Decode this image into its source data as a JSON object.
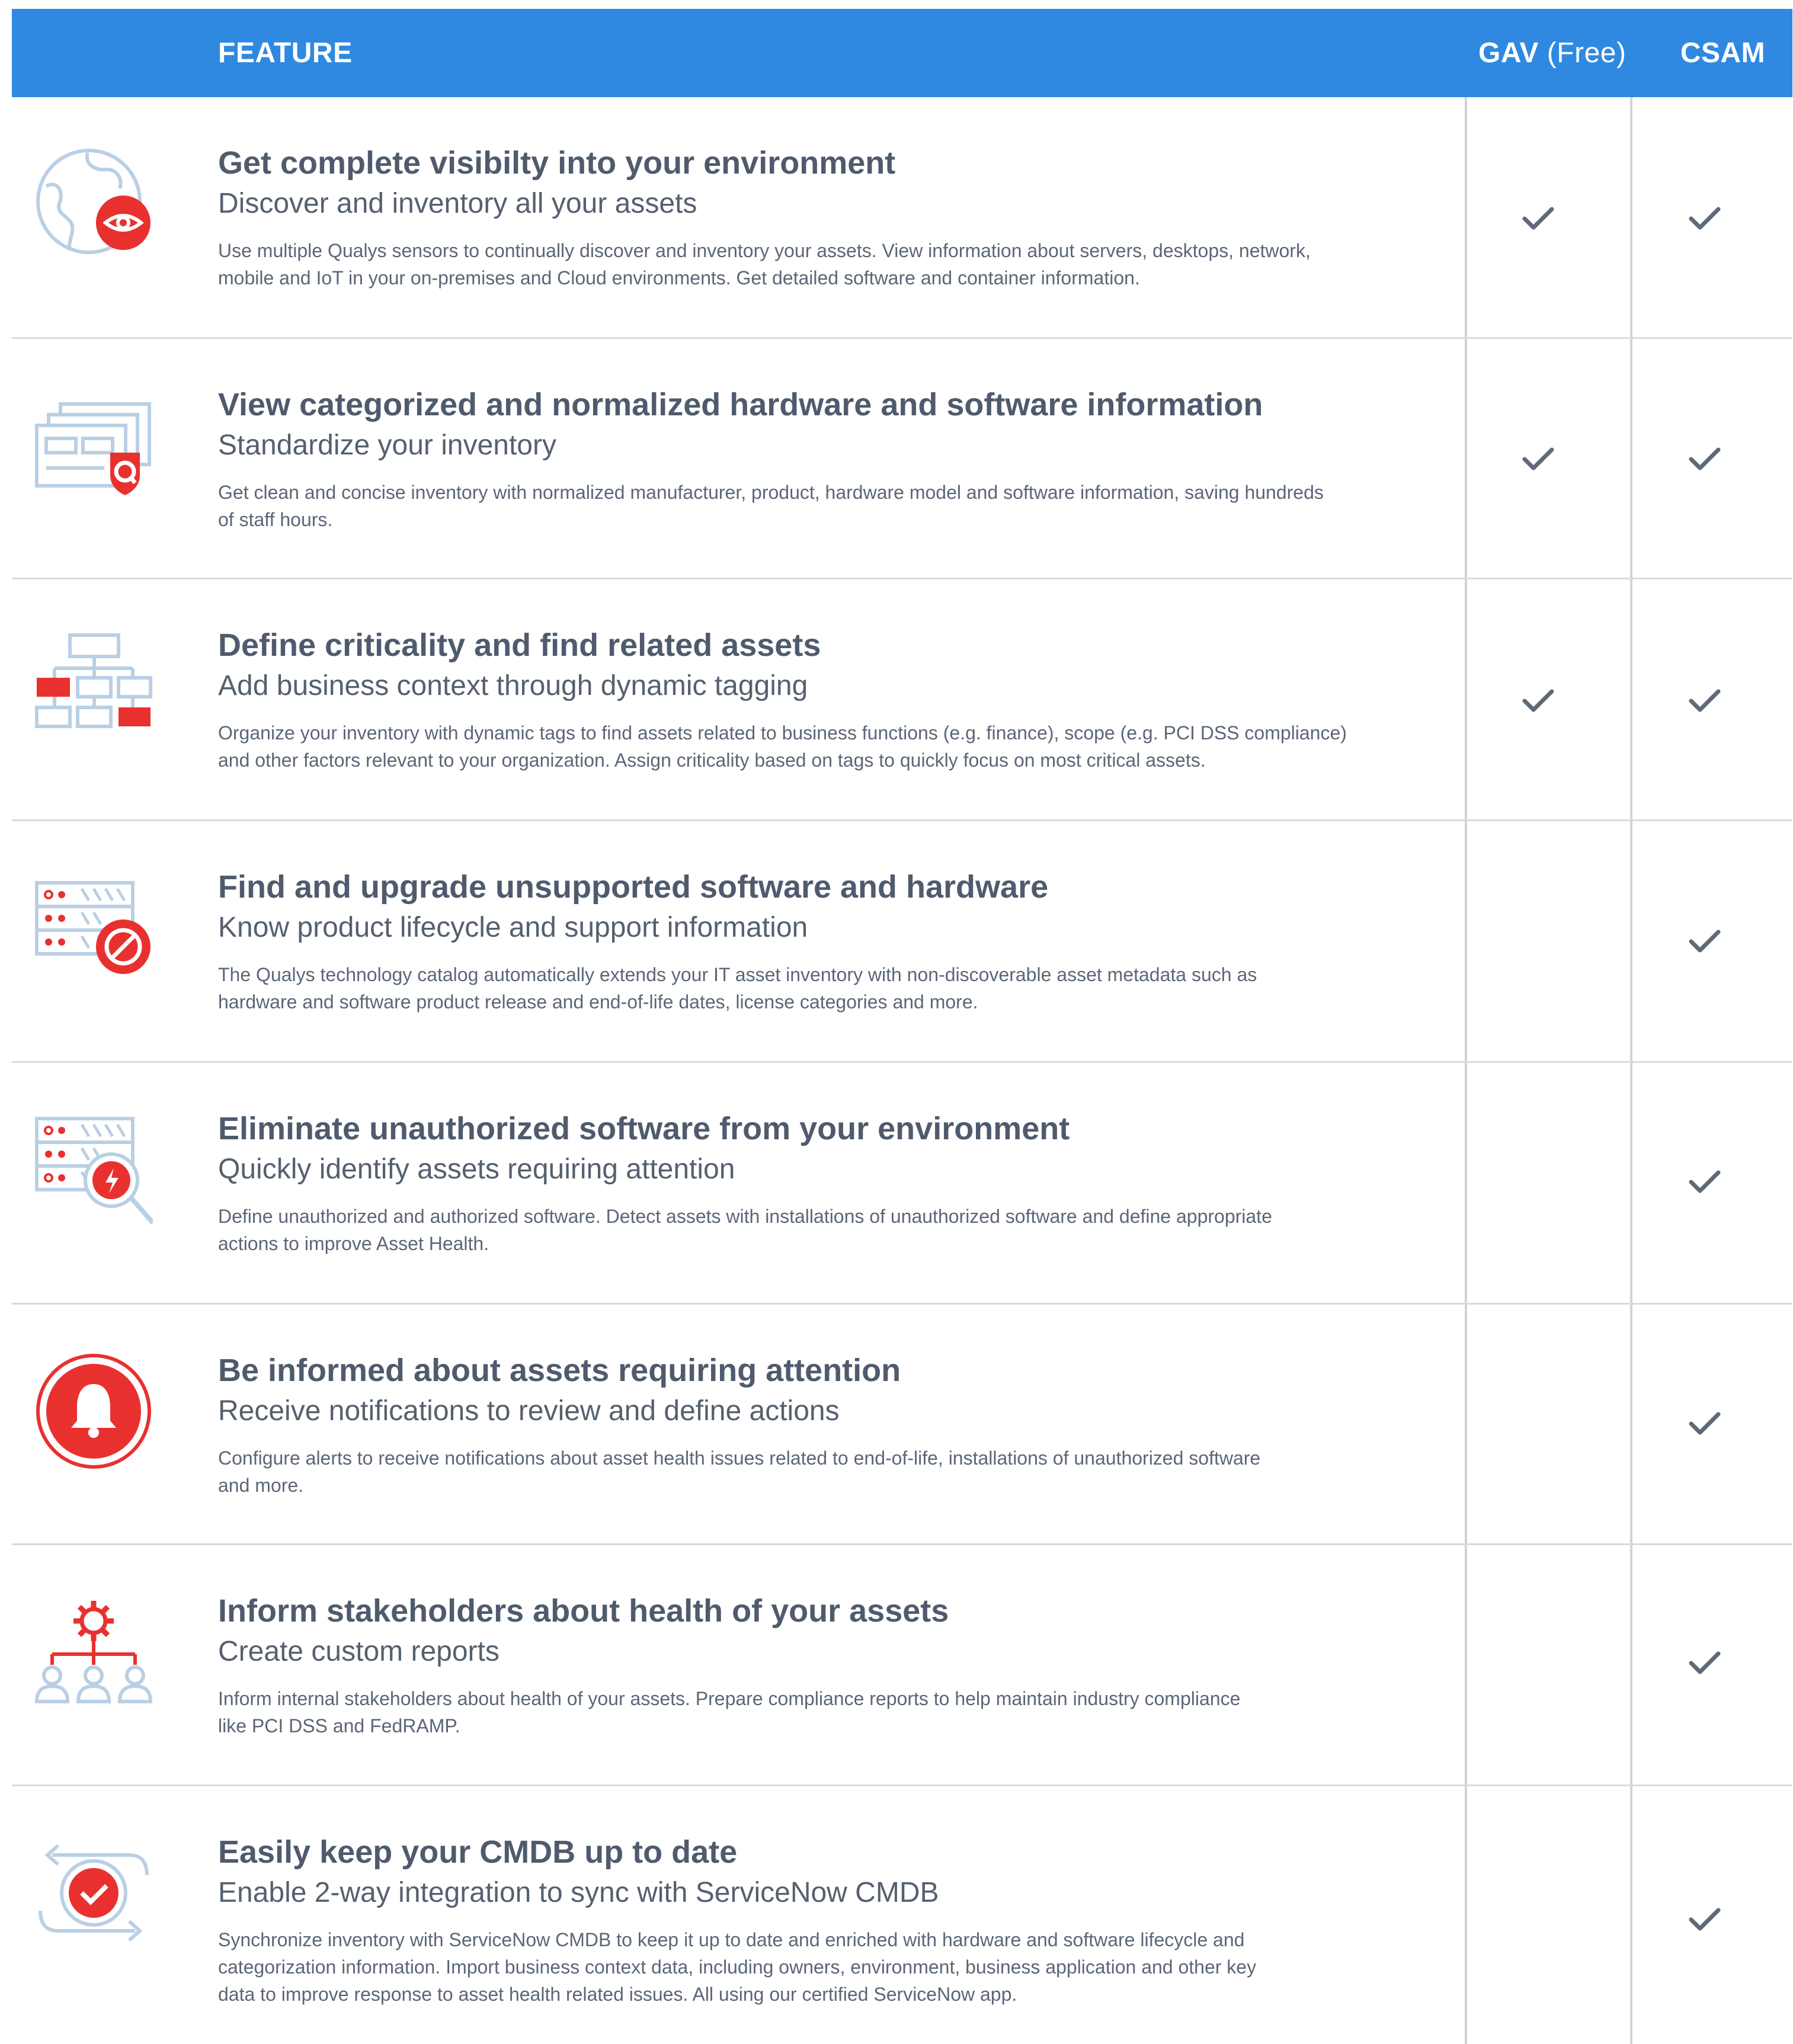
{
  "header": {
    "feature_label": "FEATURE",
    "gav_label": "GAV",
    "gav_suffix": "(Free)",
    "csam_label": "CSAM",
    "background_color": "#2f89e0"
  },
  "colors": {
    "accent_red": "#e8312f",
    "icon_outline": "#b9cfe4",
    "check": "#5f6a79"
  },
  "features": [
    {
      "icon": "globe-eye-icon",
      "title": "Get complete visibilty into your environment",
      "subtitle": "Discover and inventory all your assets",
      "description_lines": [
        "Use multiple Qualys sensors to continually discover and inventory your assets. View information about servers, desktops, network,",
        "mobile and IoT in your on-premises and Cloud environments. Get detailed software and container information."
      ],
      "gav": true,
      "csam": true
    },
    {
      "icon": "inventory-cards-icon",
      "title": "View categorized and normalized hardware and software information",
      "subtitle": "Standardize your inventory",
      "description_lines": [
        "Get clean and concise inventory with normalized manufacturer, product, hardware model and software information, saving hundreds",
        "of staff hours."
      ],
      "gav": true,
      "csam": true
    },
    {
      "icon": "hierarchy-tags-icon",
      "title": "Define criticality and find related assets",
      "subtitle": "Add business context through dynamic tagging",
      "description_lines": [
        "Organize your inventory with dynamic tags to find assets related to business functions (e.g. finance), scope (e.g. PCI DSS compliance)",
        "and other factors relevant to your organization. Assign criticality based on tags to quickly focus on most critical assets."
      ],
      "gav": true,
      "csam": true
    },
    {
      "icon": "server-blocked-icon",
      "title": "Find and upgrade unsupported software and hardware",
      "subtitle": "Know product lifecycle and support information",
      "description_lines": [
        "The Qualys technology catalog automatically extends your IT asset inventory with non-discoverable asset metadata such as",
        "hardware and software product release and end-of-life dates, license categories and more."
      ],
      "gav": false,
      "csam": true
    },
    {
      "icon": "server-search-icon",
      "title": "Eliminate unauthorized software from your environment",
      "subtitle": "Quickly identify assets requiring attention",
      "description_lines": [
        "Define unauthorized and authorized software. Detect assets with installations of unauthorized software and define appropriate",
        "actions to improve Asset Health."
      ],
      "gav": false,
      "csam": true
    },
    {
      "icon": "bell-alert-icon",
      "title": "Be informed about assets requiring attention",
      "subtitle": "Receive notifications to review and define actions",
      "description_lines": [
        "Configure alerts to receive notifications about asset health issues related to end-of-life, installations of unauthorized software",
        "and more."
      ],
      "gav": false,
      "csam": true
    },
    {
      "icon": "stakeholders-gear-icon",
      "title": "Inform stakeholders about health of your assets",
      "subtitle": "Create custom reports",
      "description_lines": [
        "Inform internal stakeholders about health of your assets. Prepare compliance reports to help maintain industry compliance",
        "like PCI DSS and FedRAMP."
      ],
      "gav": false,
      "csam": true
    },
    {
      "icon": "sync-check-icon",
      "title": "Easily keep your CMDB up to date",
      "subtitle": "Enable 2-way integration to sync with ServiceNow CMDB",
      "description_lines": [
        "Synchronize inventory with ServiceNow CMDB to keep it up to date and enriched with hardware and software lifecycle and",
        "categorization information. Import business context data, including owners, environment, business application and other key",
        "data to improve response to asset health related issues. All using our certified ServiceNow app."
      ],
      "gav": false,
      "csam": true
    }
  ]
}
